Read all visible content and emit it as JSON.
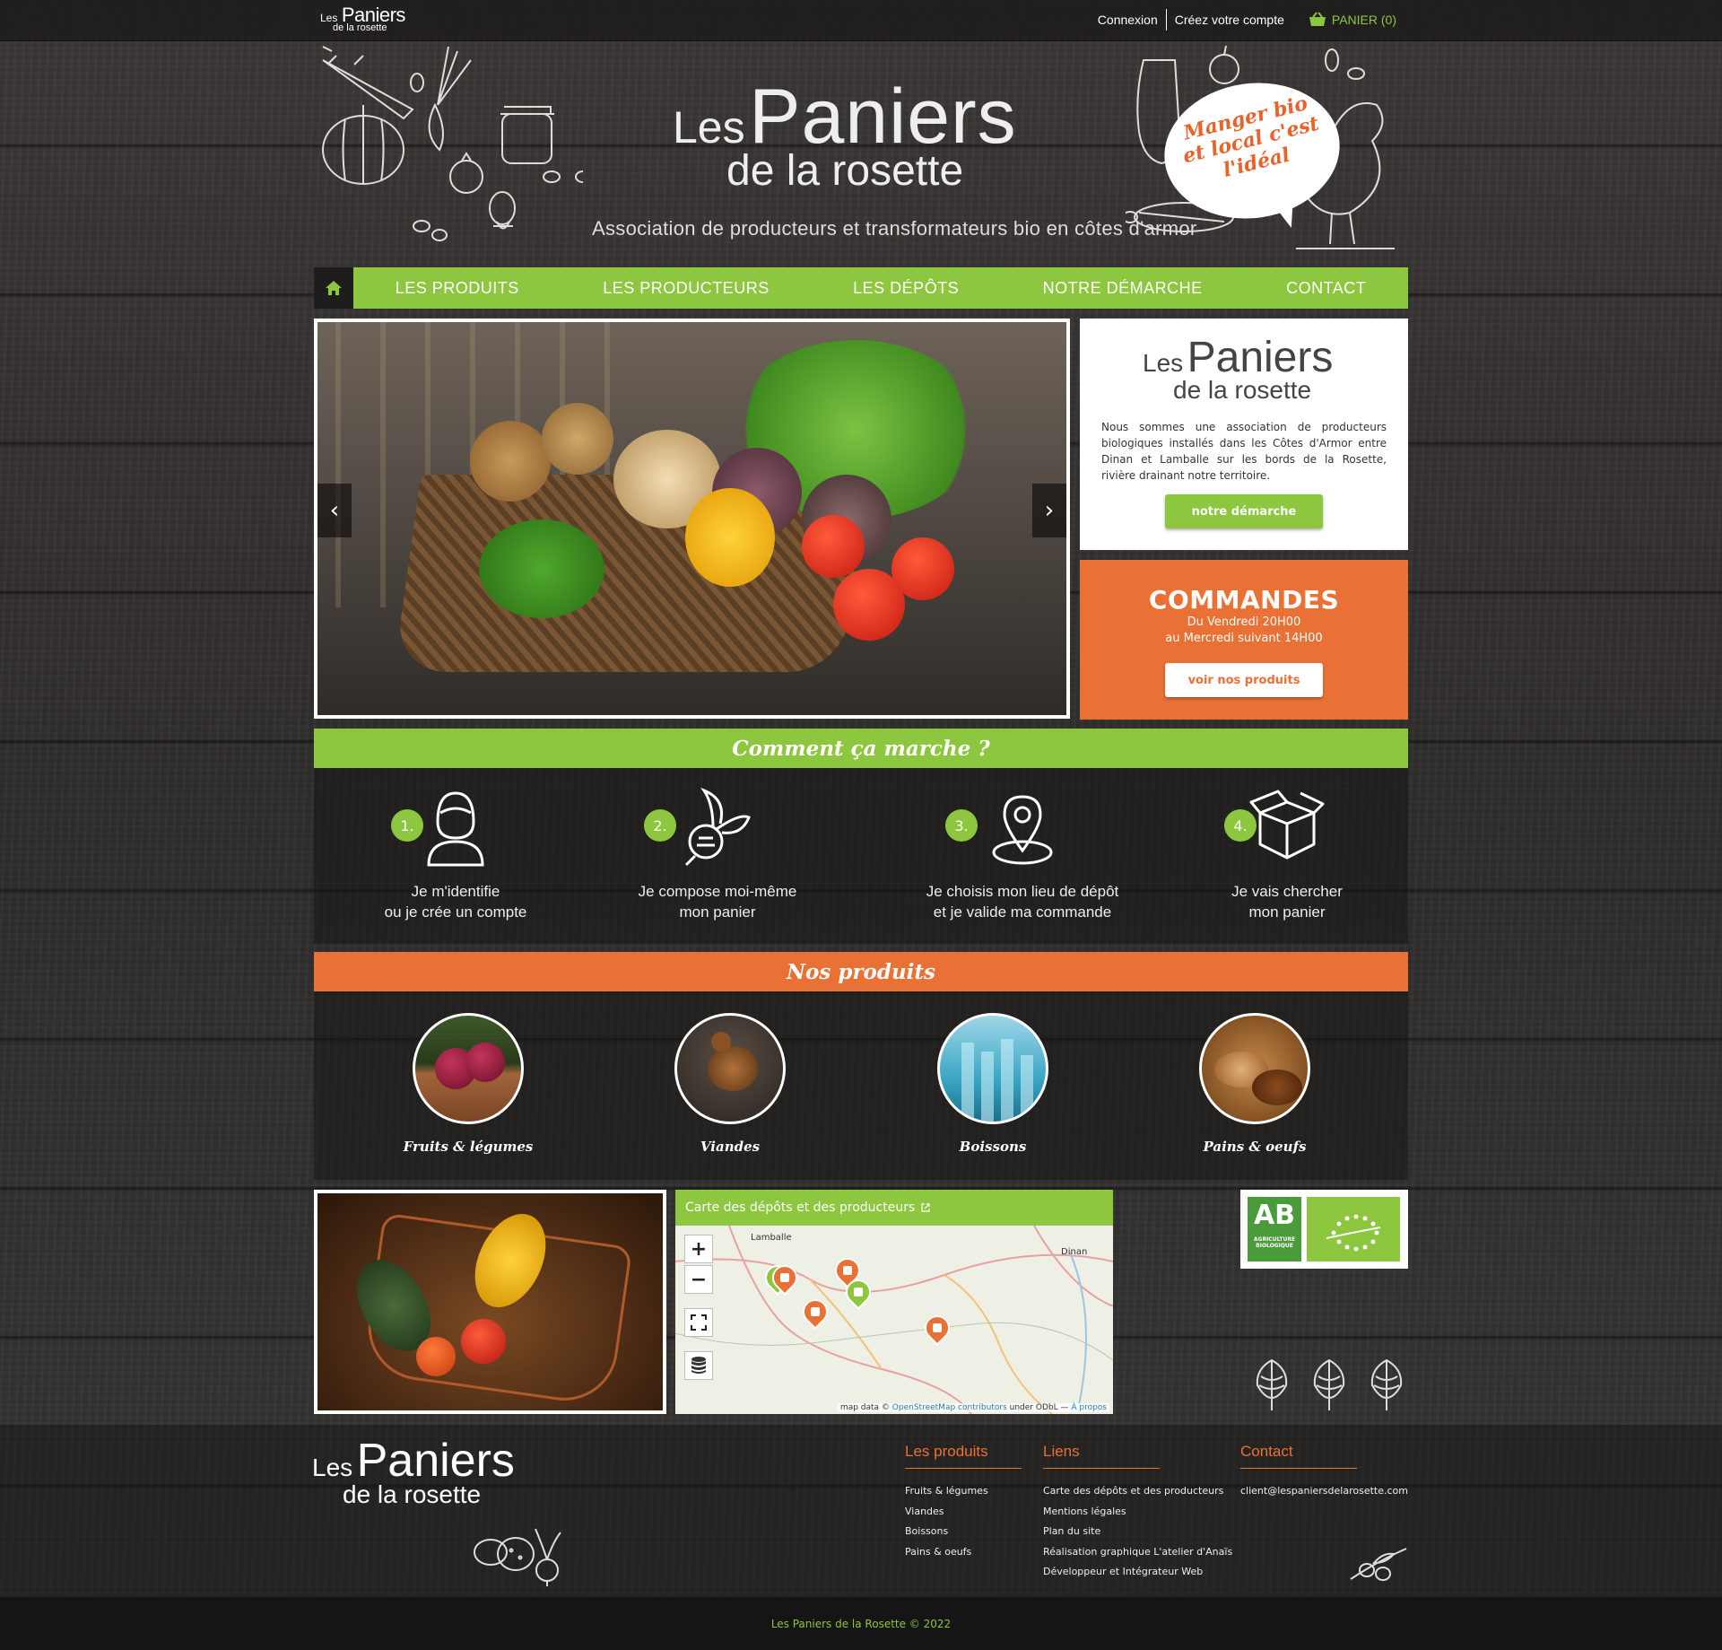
{
  "topbar": {
    "logo": {
      "les": "Les",
      "paniers": "Paniers",
      "rosette": "de la rosette"
    },
    "login": "Connexion",
    "register": "Créez votre compte",
    "cart": "PANIER (0)"
  },
  "header": {
    "title_les": "Les",
    "title_paniers": "Paniers",
    "title_rosette": "de la rosette",
    "tagline": "Association de producteurs et transformateurs bio en côtes d'armor",
    "bubble": "Manger bio et local c'est l'idéal"
  },
  "nav": {
    "items": [
      "LES PRODUITS",
      "LES PRODUCTEURS",
      "LES DÉPÔTS",
      "NOTRE DÉMARCHE",
      "CONTACT"
    ]
  },
  "slider": {
    "prev": "‹",
    "next": "›"
  },
  "infobox": {
    "les": "Les",
    "paniers": "Paniers",
    "rosette": "de la rosette",
    "text": "Nous sommes une association de producteurs biologiques installés dans les Côtes d'Armor entre Dinan et Lamballe sur les bords de la Rosette, rivière drainant notre territoire.",
    "button": "notre démarche"
  },
  "orders": {
    "title": "COMMANDES",
    "line1": "Du Vendredi 20H00",
    "line2": "au Mercredi suivant 14H00",
    "button": "voir nos produits"
  },
  "how": {
    "title": "Comment ça marche ?",
    "steps": [
      {
        "num": "1.",
        "line1": "Je m'identifie",
        "line2": "ou je crée un compte"
      },
      {
        "num": "2.",
        "line1": "Je compose moi-même",
        "line2": "mon panier"
      },
      {
        "num": "3.",
        "line1": "Je choisis mon lieu de dépôt",
        "line2": "et je valide ma commande"
      },
      {
        "num": "4.",
        "line1": "Je vais chercher",
        "line2": "mon panier"
      }
    ]
  },
  "products": {
    "title": "Nos produits",
    "categories": [
      "Fruits & légumes",
      "Viandes",
      "Boissons",
      "Pains & oeufs"
    ]
  },
  "map": {
    "title": "Carte des dépôts et des producteurs",
    "towns": [
      "Lamballe",
      "Dinan"
    ],
    "attribution_prefix": "map data ©",
    "attribution_link": "OpenStreetMap contributors",
    "attribution_mid": "under ODbL —",
    "attribution_about": "À propos"
  },
  "bio": {
    "ab": "AB",
    "ab_sub": "AGRICULTURE BIOLOGIQUE"
  },
  "footer": {
    "les": "Les",
    "paniers": "Paniers",
    "rosette": "de la rosette",
    "col1": {
      "title": "Les produits",
      "items": [
        "Fruits & légumes",
        "Viandes",
        "Boissons",
        "Pains & oeufs"
      ]
    },
    "col2": {
      "title": "Liens",
      "items": [
        "Carte des dépôts et des producteurs",
        "Mentions légales",
        "Plan du site",
        "Réalisation graphique L'atelier d'Anaïs",
        "Développeur et Intégrateur Web"
      ]
    },
    "col3": {
      "title": "Contact",
      "items": [
        "client@lespaniersdelarosette.com"
      ]
    },
    "copyright": "Les Paniers de la Rosette © 2022"
  },
  "colors": {
    "green": "#8dc63f",
    "orange": "#e97135",
    "dark": "#1d1d1b"
  }
}
